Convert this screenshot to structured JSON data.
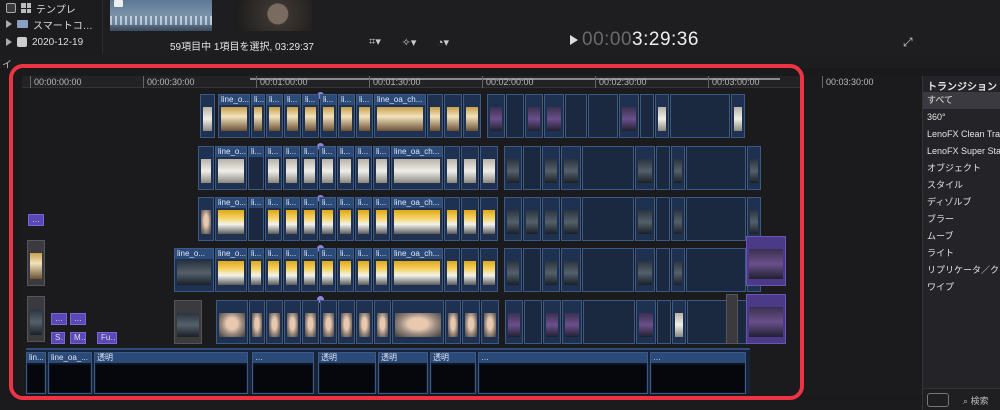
{
  "library": {
    "items": [
      {
        "label": "テンプレ",
        "icon": "grid-icon"
      },
      {
        "label": "スマートコ…",
        "icon": "folder-icon"
      },
      {
        "label": "2020-12-19",
        "icon": "calendar-icon"
      }
    ]
  },
  "browser": {
    "status": "59項目中 1項目を選択, 03:29:37"
  },
  "viewer": {
    "timecode_dim": "00:00",
    "timecode": "3:29:36"
  },
  "index_label": "イ",
  "ruler": {
    "ticks": [
      "00:00:00:00",
      "00:00:30:00",
      "00:01:00:00",
      "00:01:30:00",
      "00:02:00:00",
      "00:02:30:00",
      "00:03:00:00",
      "00:03:30:00"
    ]
  },
  "tracks": {
    "clip_label_main": "line_o...",
    "clip_label_long": "line_oa_ch...",
    "clip_label_short": "li...",
    "clip_label_tiny": "li"
  },
  "mini_clips": [
    "…",
    "S…",
    "M…",
    "Fu…",
    "…",
    "…"
  ],
  "storyline": {
    "clips": [
      "lin...",
      "line_oa_...",
      "透明",
      "…",
      "透明",
      "…",
      "透明",
      "透明"
    ],
    "bottom_label": "line_oa_ch..."
  },
  "sidebar": {
    "title": "トランジション",
    "items": [
      "すべて",
      "360°",
      "LenoFX Clean Transitions",
      "LenoFX Super Starter",
      "オブジェクト",
      "スタイル",
      "ディゾルブ",
      "ブラー",
      "ムーブ",
      "ライト",
      "リプリケータ／クローン",
      "ワイプ"
    ],
    "selected_index": 0,
    "search_label": "検索"
  },
  "colors": {
    "highlight": "#ee3344",
    "clip_blue": "#2c4a78",
    "connected_violet": "#5b48b8"
  }
}
